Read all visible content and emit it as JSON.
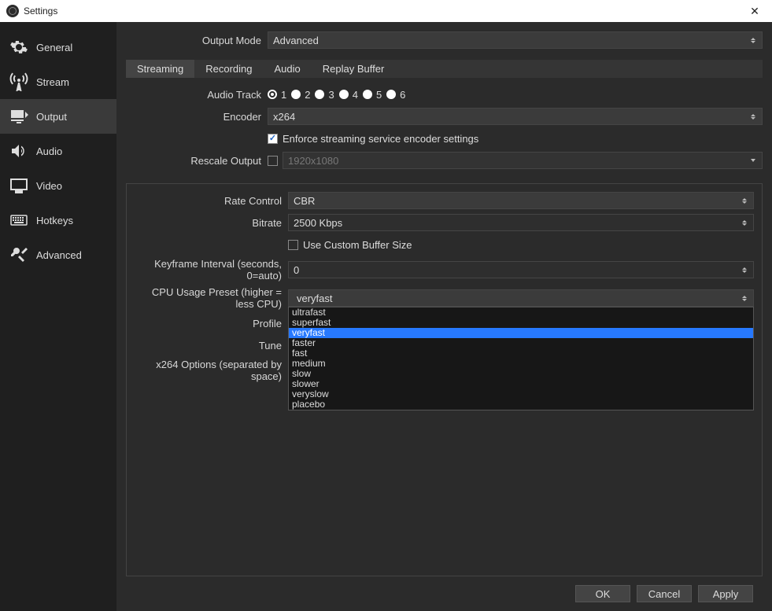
{
  "window": {
    "title": "Settings"
  },
  "sidebar": {
    "items": [
      {
        "label": "General"
      },
      {
        "label": "Stream"
      },
      {
        "label": "Output"
      },
      {
        "label": "Audio"
      },
      {
        "label": "Video"
      },
      {
        "label": "Hotkeys"
      },
      {
        "label": "Advanced"
      }
    ],
    "selected_index": 2
  },
  "output_mode": {
    "label": "Output Mode",
    "value": "Advanced"
  },
  "tabs": {
    "items": [
      {
        "label": "Streaming"
      },
      {
        "label": "Recording"
      },
      {
        "label": "Audio"
      },
      {
        "label": "Replay Buffer"
      }
    ],
    "active_index": 0
  },
  "audio_track": {
    "label": "Audio Track",
    "options": [
      "1",
      "2",
      "3",
      "4",
      "5",
      "6"
    ],
    "selected_index": 0
  },
  "encoder": {
    "label": "Encoder",
    "value": "x264"
  },
  "enforce": {
    "label": "Enforce streaming service encoder settings",
    "checked": true
  },
  "rescale": {
    "label": "Rescale Output",
    "checked": false,
    "placeholder": "1920x1080"
  },
  "rate_control": {
    "label": "Rate Control",
    "value": "CBR"
  },
  "bitrate": {
    "label": "Bitrate",
    "value": "2500 Kbps"
  },
  "custom_buffer": {
    "label": "Use Custom Buffer Size",
    "checked": false
  },
  "keyframe": {
    "label": "Keyframe Interval (seconds, 0=auto)",
    "value": "0"
  },
  "cpu_preset": {
    "label": "CPU Usage Preset (higher = less CPU)",
    "value": "veryfast",
    "options": [
      "ultrafast",
      "superfast",
      "veryfast",
      "faster",
      "fast",
      "medium",
      "slow",
      "slower",
      "veryslow",
      "placebo"
    ],
    "selected_option_index": 2
  },
  "profile": {
    "label": "Profile"
  },
  "tune": {
    "label": "Tune"
  },
  "x264_options": {
    "label": "x264 Options (separated by space)"
  },
  "footer": {
    "ok": "OK",
    "cancel": "Cancel",
    "apply": "Apply"
  }
}
